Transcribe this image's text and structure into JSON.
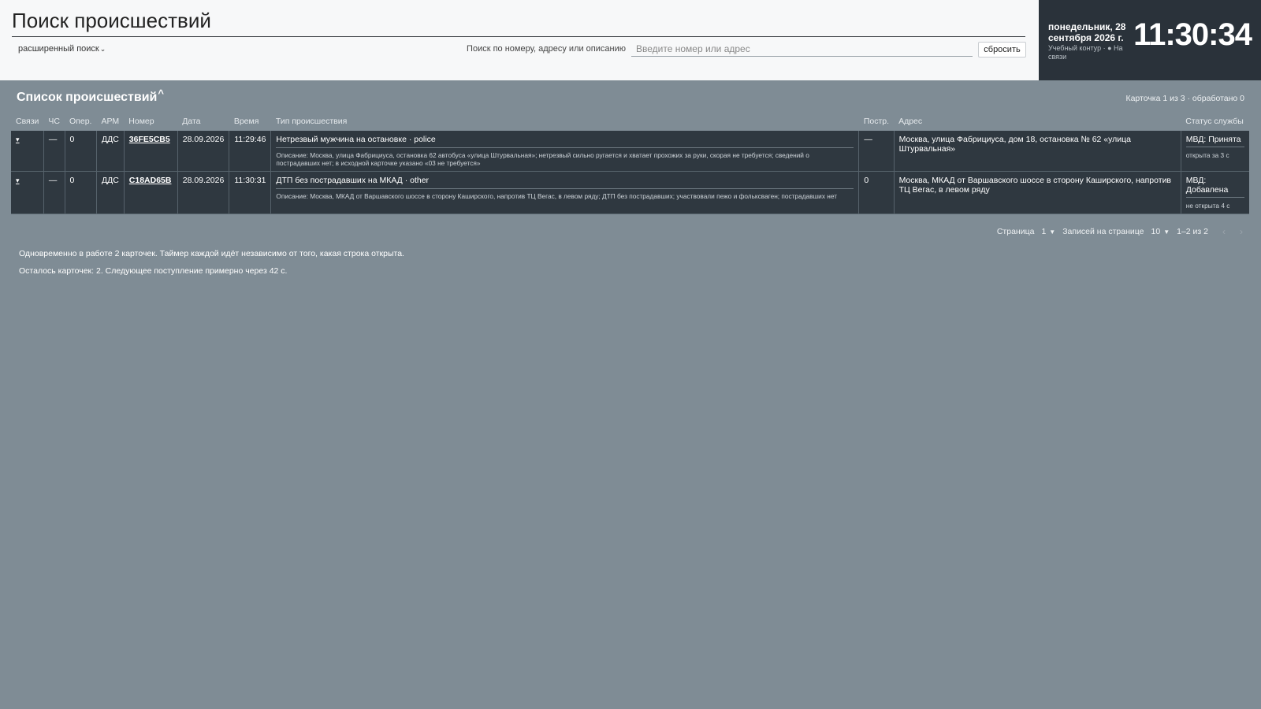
{
  "header": {
    "title": "Поиск происшествий",
    "advanced_search": "расширенный поиск",
    "search_label": "Поиск по номеру, адресу или описанию",
    "search_placeholder": "Введите номер или адрес",
    "search_value": "",
    "reset_label": "сбросить"
  },
  "clock": {
    "date": "понедельник, 28 сентября 2026 г.",
    "status": "Учебный контур · ● На связи",
    "time": "11:30:34"
  },
  "list": {
    "title": "Список происшествий",
    "counter": "Карточка 1 из 3 · обработано 0",
    "columns": {
      "links": "Связи",
      "emergency": "ЧС",
      "oper": "Опер.",
      "arm": "АРМ",
      "number": "Номер",
      "date": "Дата",
      "time": "Время",
      "type": "Тип происшествия",
      "postr": "Постр.",
      "address": "Адрес",
      "status": "Статус службы"
    },
    "rows": [
      {
        "toggle": "▾",
        "emergency": "—",
        "oper": "0",
        "arm": "ДДС",
        "number": "36FE5CB5",
        "date": "28.09.2026",
        "time": "11:29:46",
        "type": "Нетрезвый мужчина на остановке · police",
        "description": "Описание: Москва, улица Фабрициуса, остановка 62 автобуса «улица Штурвальная»; нетрезвый сильно ругается и хватает прохожих за руки, скорая не требуется; сведений о пострадавших нет; в исходной карточке указано «03 не требуется»",
        "postr": "—",
        "address": "Москва, улица Фабрициуса, дом 18, остановка № 62 «улица Штурвальная»",
        "status": "МВД: Принята",
        "status_sub": "открыта за 3 с"
      },
      {
        "toggle": "▾",
        "emergency": "—",
        "oper": "0",
        "arm": "ДДС",
        "number": "C18AD65B",
        "date": "28.09.2026",
        "time": "11:30:31",
        "type": "ДТП без пострадавших на МКАД · other",
        "description": "Описание: Москва, МКАД от Варшавского шоссе в сторону Каширского, напротив ТЦ Вегас, в левом ряду; ДТП без пострадавших; участвовали пежо и фольксваген; пострадавших нет",
        "postr": "0",
        "address": "Москва, МКАД от Варшавского шоссе в сторону Каширского, напротив ТЦ Вегас, в левом ряду",
        "status": "МВД: Добавлена",
        "status_sub": "не открыта 4 с"
      }
    ]
  },
  "pager": {
    "page_label": "Страница",
    "page_value": "1",
    "per_page_label": "Записей на странице",
    "per_page_value": "10",
    "range": "1–2 из 2",
    "prev": "‹",
    "next": "›"
  },
  "notes": {
    "line1": "Одновременно в работе 2 карточек. Таймер каждой идёт независимо от того, какая строка открыта.",
    "line2": "Осталось карточек: 2. Следующее поступление примерно через 42 с."
  }
}
